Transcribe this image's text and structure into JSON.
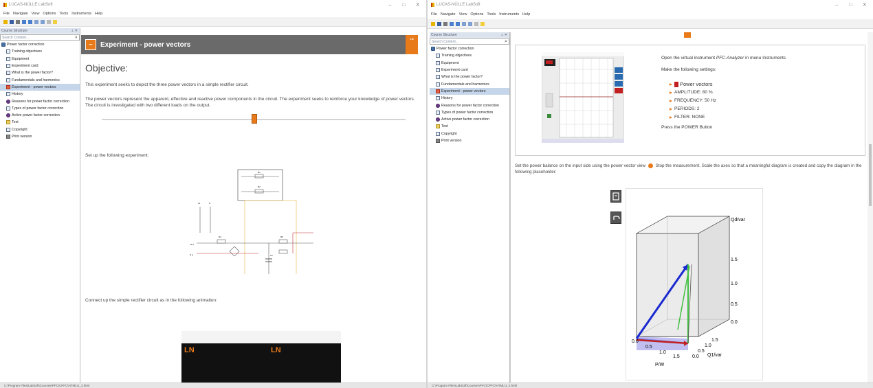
{
  "app": {
    "title": "LUCAS-NÜLLE LabSoft",
    "minimize": "–",
    "maximize": "□",
    "close": "X"
  },
  "menu": [
    "File",
    "Navigate",
    "View",
    "Options",
    "Tools",
    "Instruments",
    "Help"
  ],
  "sidebar": {
    "header": "Course Structure",
    "header_controls": "⊥ ✕",
    "search_placeholder": "Search Content...",
    "root": "Power factor correction",
    "items": [
      "Training objectives",
      "Equipment",
      "Experiment card",
      "What is the power factor?",
      "Fundamentals and harmonics",
      "Experiment - power vectors",
      "History",
      "Reasons for power factor correction",
      "Types of power factor correction",
      "Active power factor correction",
      "Test",
      "Copyright",
      "Print version"
    ],
    "selected": "Experiment - power vectors"
  },
  "left_page": {
    "header_title": "Experiment - power vectors",
    "logo_text": "LN",
    "objective_heading": "Objective:",
    "p1": "This experiment seeks to depict the three power vectors in a simple rectifier circuit.",
    "p2": "The power vectors represent the apparent, effective and reactive power components in the circuit. The experiment seeks to reinforce your knowledge of power vectors. The circuit is investigated with two different loads on the output.",
    "setup": "Set up the following experiment:",
    "connect": "Connect up the simple rectifier circuit as in the following animation:",
    "circuit_labels": {
      "r1": "R1",
      "r2": "R2",
      "l1": "L1",
      "n": "N",
      "l1in": "L1 ●",
      "nin": "N ●",
      "pe": "PE",
      "c1": "C1",
      "r4": "R4",
      "r5": "R5",
      "r6": "R6"
    },
    "anim_logo": "LN"
  },
  "right_page": {
    "ins_open_a": "Open the virtual instrument ",
    "ins_open_em": "PFC-Analyzer",
    "ins_open_b": " in menu Instruments",
    "ins_settings": "Make the following settings:",
    "power_vectors": "Power vectors",
    "bullets": [
      "AMPLITUDE: 80 %",
      "FREQUENCY: 50 Hz",
      "PERIODS: 2",
      "FILTER: NONE"
    ],
    "press": "Press the POWER Button",
    "balance_a": "Set the power balance on the input side using the power vector view",
    "balance_b": "Stop the measurement. Scale the axes so that a meaningful diagram is created and copy the diagram in the following placeholder:",
    "axis_labels": {
      "qd": "Qd/var",
      "p": "P/W",
      "q1": "Q1/var",
      "ticks_v": [
        "1.5",
        "1.0",
        "0.5",
        "0.0"
      ],
      "ticks_p": [
        "0.0",
        "0.5",
        "1.0",
        "1.5"
      ],
      "ticks_q": [
        "0.0",
        "0.5",
        "1.0",
        "1.5"
      ]
    }
  },
  "status": {
    "left": "C:\\Program Files\\LabSoft\\Courses\\PFC\\CPFC\\HTML\\1_3.html",
    "right": "C:\\Program Files\\LabSoft\\Courses\\PFC\\CPFC\\HTML\\1_4.html"
  },
  "colors": {
    "accent": "#e87a1a",
    "header_bg": "#6a6a6a",
    "selected": "#c5d5ea"
  }
}
